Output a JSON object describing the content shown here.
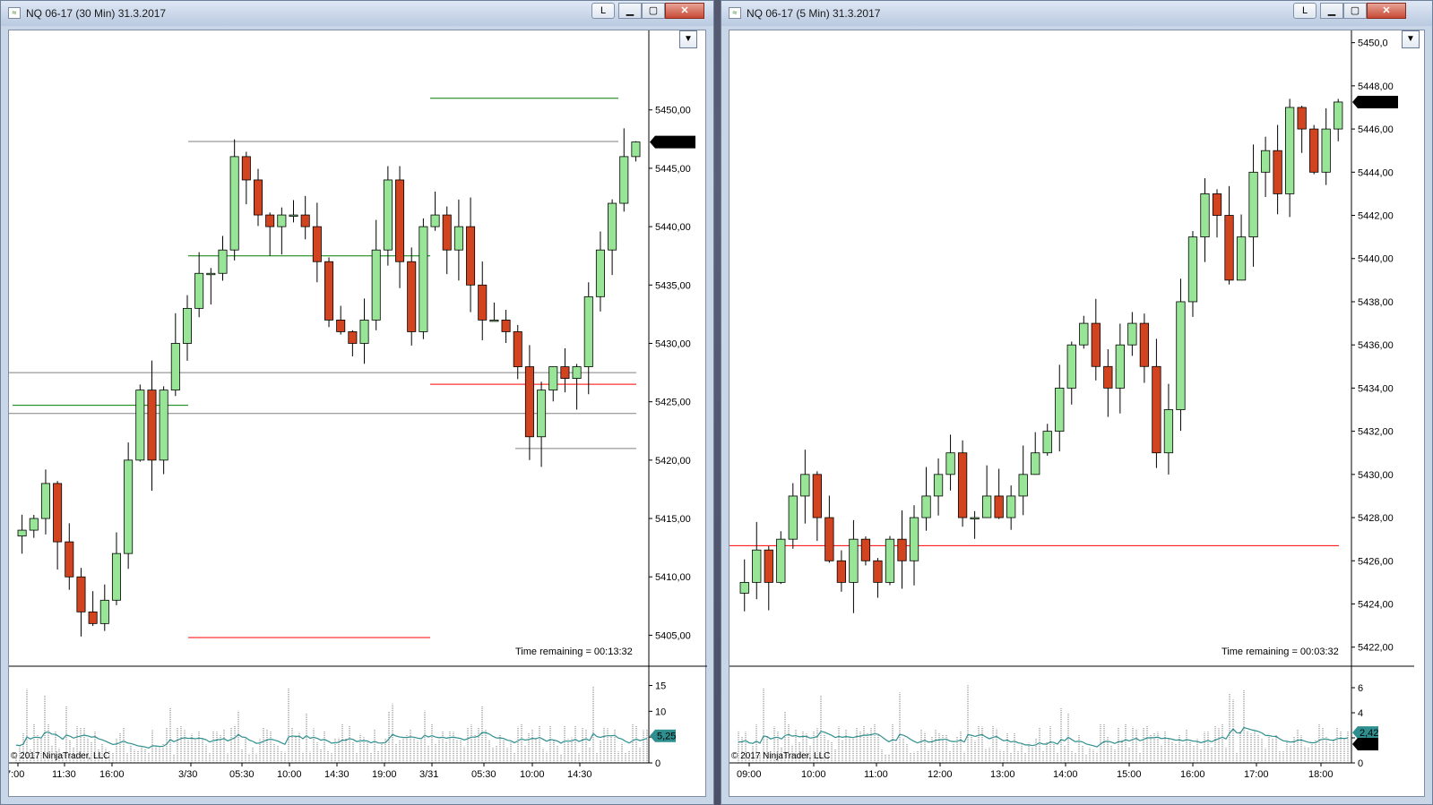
{
  "windows": [
    {
      "title": "NQ 06-17 (30 Min)  31.3.2017",
      "l_button": "L",
      "price_axis": [
        "5450,00",
        "5445,00",
        "5440,00",
        "5435,00",
        "5430,00",
        "5425,00",
        "5420,00",
        "5415,00",
        "5410,00",
        "5405,00"
      ],
      "current_price": "5447,25",
      "time_remaining": "Time remaining = 00:13:32",
      "volume_axis": [
        "15",
        "10",
        "5",
        "0"
      ],
      "volume_labels": [
        "5,25"
      ],
      "time_axis": [
        "7:00",
        "11:30",
        "16:00",
        "3/30",
        "05:30",
        "10:00",
        "14:30",
        "19:00",
        "3/31",
        "05:30",
        "10:00",
        "14:30"
      ],
      "copyright": "© 2017 NinjaTrader, LLC"
    },
    {
      "title": "NQ 06-17 (5 Min)  31.3.2017",
      "l_button": "L",
      "price_axis": [
        "5450,0",
        "5448,00",
        "5446,00",
        "5444,00",
        "5442,00",
        "5440,00",
        "5438,00",
        "5436,00",
        "5434,00",
        "5432,00",
        "5430,00",
        "5428,00",
        "5426,00",
        "5424,00",
        "5422,00"
      ],
      "current_price": "5447,25",
      "time_remaining": "Time remaining = 00:03:32",
      "volume_axis": [
        "6",
        "4",
        "2",
        "0"
      ],
      "volume_labels": [
        "2,42",
        "1,5"
      ],
      "time_axis": [
        "09:00",
        "10:00",
        "11:00",
        "12:00",
        "13:00",
        "14:00",
        "15:00",
        "16:00",
        "17:00",
        "18:00"
      ],
      "copyright": "© 2017 NinjaTrader, LLC"
    }
  ],
  "chart_data": [
    {
      "type": "candlestick",
      "title": "NQ 06-17 (30 Min)  31.3.2017",
      "price_range": [
        5402.5,
        5456.5
      ],
      "close_path": [
        5414,
        5415,
        5418,
        5413,
        5410,
        5407,
        5406,
        5408,
        5412,
        5420,
        5426,
        5420,
        5426,
        5430,
        5433,
        5436,
        5436,
        5438,
        5446,
        5444,
        5441,
        5440,
        5441,
        5441,
        5440,
        5437,
        5432,
        5431,
        5430,
        5432,
        5438,
        5444,
        5437,
        5431,
        5440,
        5441,
        5438,
        5440,
        5435,
        5432,
        5432,
        5431,
        5428,
        5422,
        5426,
        5428,
        5427,
        5428,
        5434,
        5438,
        5442,
        5446,
        5447.25
      ],
      "horizontal_lines": [
        {
          "color": "#008000",
          "price": 5451.0
        },
        {
          "color": "#808080",
          "price": 5447.3
        },
        {
          "color": "#008000",
          "price": 5437.5
        },
        {
          "color": "#808080",
          "price": 5427.5
        },
        {
          "color": "#ff0000",
          "price": 5426.5
        },
        {
          "color": "#008000",
          "price": 5424.7
        },
        {
          "color": "#808080",
          "price": 5424.0
        },
        {
          "color": "#808080",
          "price": 5421.0
        },
        {
          "color": "#ff0000",
          "price": 5404.8
        }
      ],
      "volume_range": [
        0,
        17
      ]
    },
    {
      "type": "candlestick",
      "title": "NQ 06-17 (5 Min)  31.3.2017",
      "price_range": [
        5421.2,
        5450.4
      ],
      "close_path": [
        5425,
        5426.5,
        5425,
        5427,
        5429,
        5430,
        5428,
        5426,
        5425,
        5427,
        5426,
        5425,
        5427,
        5426,
        5428,
        5429,
        5430,
        5431,
        5428,
        5428,
        5429,
        5428,
        5429,
        5430,
        5431,
        5432,
        5434,
        5436,
        5437,
        5435,
        5434,
        5436,
        5437,
        5435,
        5431,
        5433,
        5438,
        5441,
        5443,
        5442,
        5439,
        5441,
        5444,
        5445,
        5443,
        5447,
        5446,
        5444,
        5446,
        5447.25
      ],
      "horizontal_lines": [
        {
          "color": "#ff0000",
          "price": 5426.7
        }
      ],
      "volume_range": [
        0,
        7
      ]
    }
  ]
}
